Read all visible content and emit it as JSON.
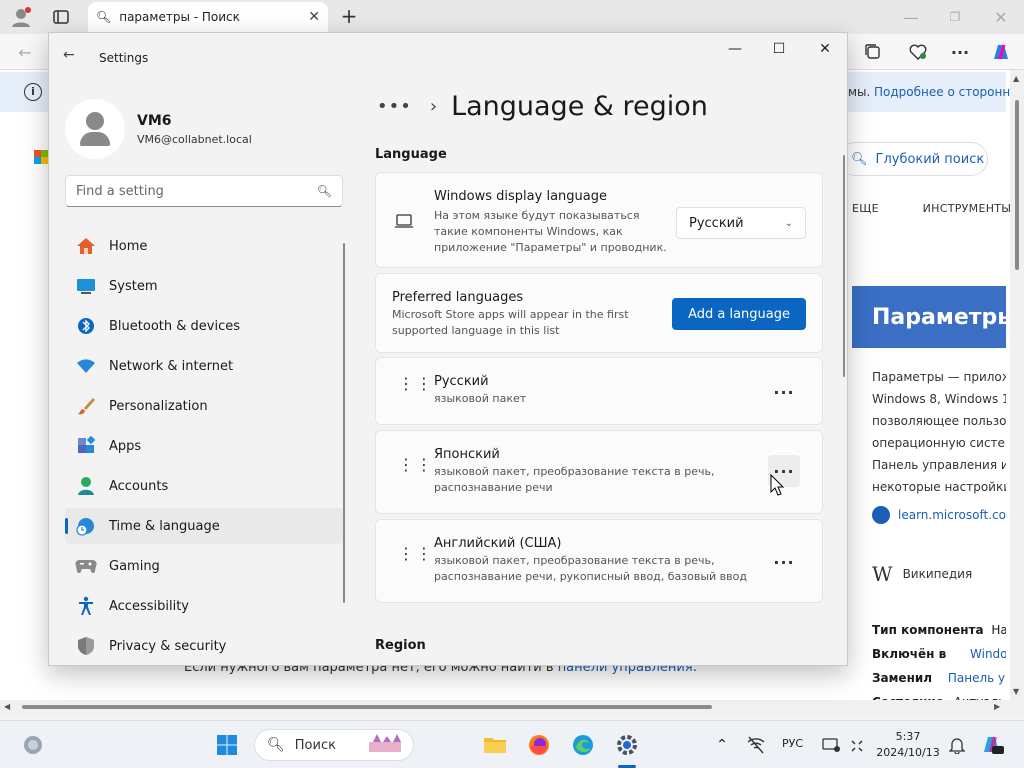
{
  "browser": {
    "tab_title": "параметры - Поиск",
    "notice_text": "мы.",
    "notice_link": "Подробнее о сторонн",
    "deep_search": "Глубокий поиск",
    "nav_more": "ЕЩЕ",
    "nav_tools": "ИНСТРУМЕНТЫ",
    "card_title": "Параметры",
    "card_lines": [
      "Параметры — прилож",
      "Windows 8, Windows 1",
      "позволяющее пользо",
      "операционную систем",
      "Панель управления и",
      "некоторые настройки,"
    ],
    "card_link": "learn.microsoft.co",
    "wiki": "Википедия",
    "facts": [
      {
        "label": "Тип компонента",
        "value": "На"
      },
      {
        "label": "Включён в",
        "value": "Windows"
      },
      {
        "label": "Заменил",
        "value": "Панель упр"
      },
      {
        "label": "Состояние",
        "value": "Актуаль"
      }
    ],
    "bottom_text": "Если нужного вам параметра нет, его можно найти в ",
    "bottom_link": "панели управления",
    "bottom_end": "."
  },
  "settings": {
    "title": "Settings",
    "profile": {
      "name": "VM6",
      "email": "VM6@collabnet.local"
    },
    "search_placeholder": "Find a setting",
    "nav": [
      {
        "label": "Home",
        "icon": "home-icon"
      },
      {
        "label": "System",
        "icon": "system-icon"
      },
      {
        "label": "Bluetooth & devices",
        "icon": "bluetooth-icon"
      },
      {
        "label": "Network & internet",
        "icon": "wifi-icon"
      },
      {
        "label": "Personalization",
        "icon": "brush-icon"
      },
      {
        "label": "Apps",
        "icon": "apps-icon"
      },
      {
        "label": "Accounts",
        "icon": "account-icon"
      },
      {
        "label": "Time & language",
        "icon": "globe-clock-icon"
      },
      {
        "label": "Gaming",
        "icon": "gamepad-icon"
      },
      {
        "label": "Accessibility",
        "icon": "accessibility-icon"
      },
      {
        "label": "Privacy & security",
        "icon": "shield-icon"
      }
    ],
    "active_nav": "Time & language",
    "breadcrumb_dots": "•••",
    "page_title": "Language & region",
    "section_language": "Language",
    "display_language": {
      "title": "Windows display language",
      "desc": "На этом языке будут показываться такие компоненты Windows, как приложение \"Параметры\" и проводник.",
      "value": "Русский"
    },
    "preferred": {
      "title": "Preferred languages",
      "desc": "Microsoft Store apps will appear in the first supported language in this list",
      "button": "Add a language"
    },
    "languages": [
      {
        "name": "Русский",
        "desc": "языковой пакет"
      },
      {
        "name": "Японский",
        "desc": "языковой пакет, преобразование текста в речь, распознавание речи"
      },
      {
        "name": "Английский (США)",
        "desc": "языковой пакет, преобразование текста в речь, распознавание речи, рукописный ввод, базовый ввод"
      }
    ],
    "section_region": "Region"
  },
  "taskbar": {
    "search": "Поиск",
    "lang": "РУС",
    "time": "5:37",
    "date": "2024/10/13"
  },
  "colors": {
    "accent": "#0a66c2"
  }
}
